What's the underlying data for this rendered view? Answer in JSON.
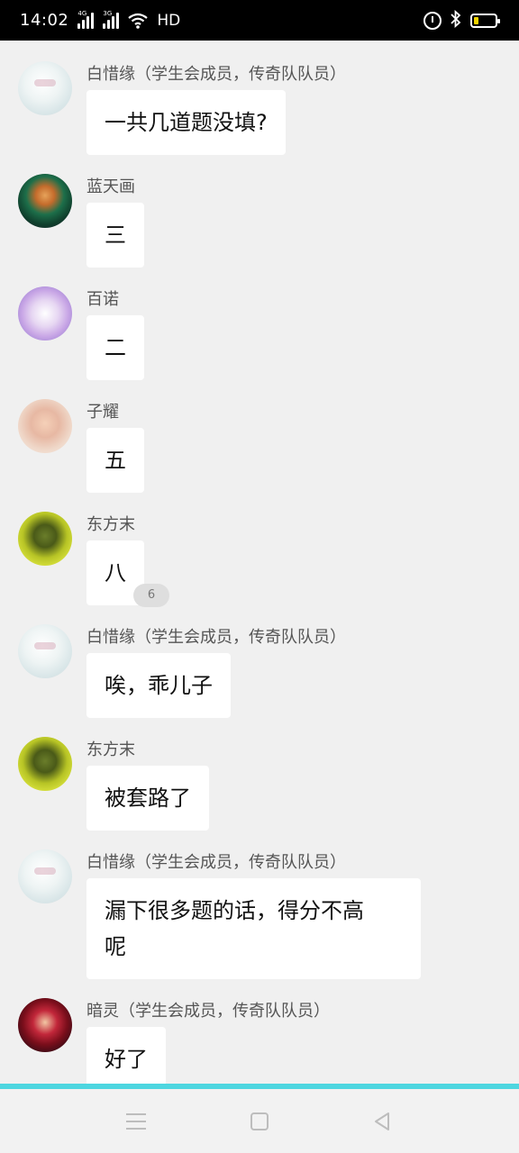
{
  "status_bar": {
    "time": "14:02",
    "signal1_label": "4G",
    "signal2_label": "3G",
    "hd_label": "HD",
    "battery_color": "#f1d400"
  },
  "messages": [
    {
      "sender": "白惜缘（学生会成员，传奇队队员）",
      "text": "一共几道题没填?",
      "avatar": "avatar-white-hair"
    },
    {
      "sender": "蓝天画",
      "text": "三",
      "avatar": "avatar-green-character"
    },
    {
      "sender": "百诺",
      "text": "二",
      "avatar": "avatar-purple-sparkle"
    },
    {
      "sender": "子耀",
      "text": "五",
      "avatar": "avatar-peach-face"
    },
    {
      "sender": "东方末",
      "text": "八",
      "avatar": "avatar-lime-character",
      "reaction_count": "6"
    },
    {
      "sender": "白惜缘（学生会成员，传奇队队员）",
      "text": "唉，乖儿子",
      "avatar": "avatar-white-hair"
    },
    {
      "sender": "东方末",
      "text": "被套路了",
      "avatar": "avatar-lime-character"
    },
    {
      "sender": "白惜缘（学生会成员，传奇队队员）",
      "text_line1": "漏下很多题的话，得分不高",
      "text_line2": "呢",
      "avatar": "avatar-white-hair"
    },
    {
      "sender": "暗灵（学生会成员，传奇队队员）",
      "text": "好了",
      "avatar": "avatar-red-character"
    }
  ],
  "colors": {
    "background": "#f0f0f0",
    "bubble": "#ffffff",
    "accent_line": "#4dd6e0"
  },
  "nav_bar": {
    "icons": [
      "menu-icon",
      "home-icon",
      "back-icon"
    ]
  }
}
